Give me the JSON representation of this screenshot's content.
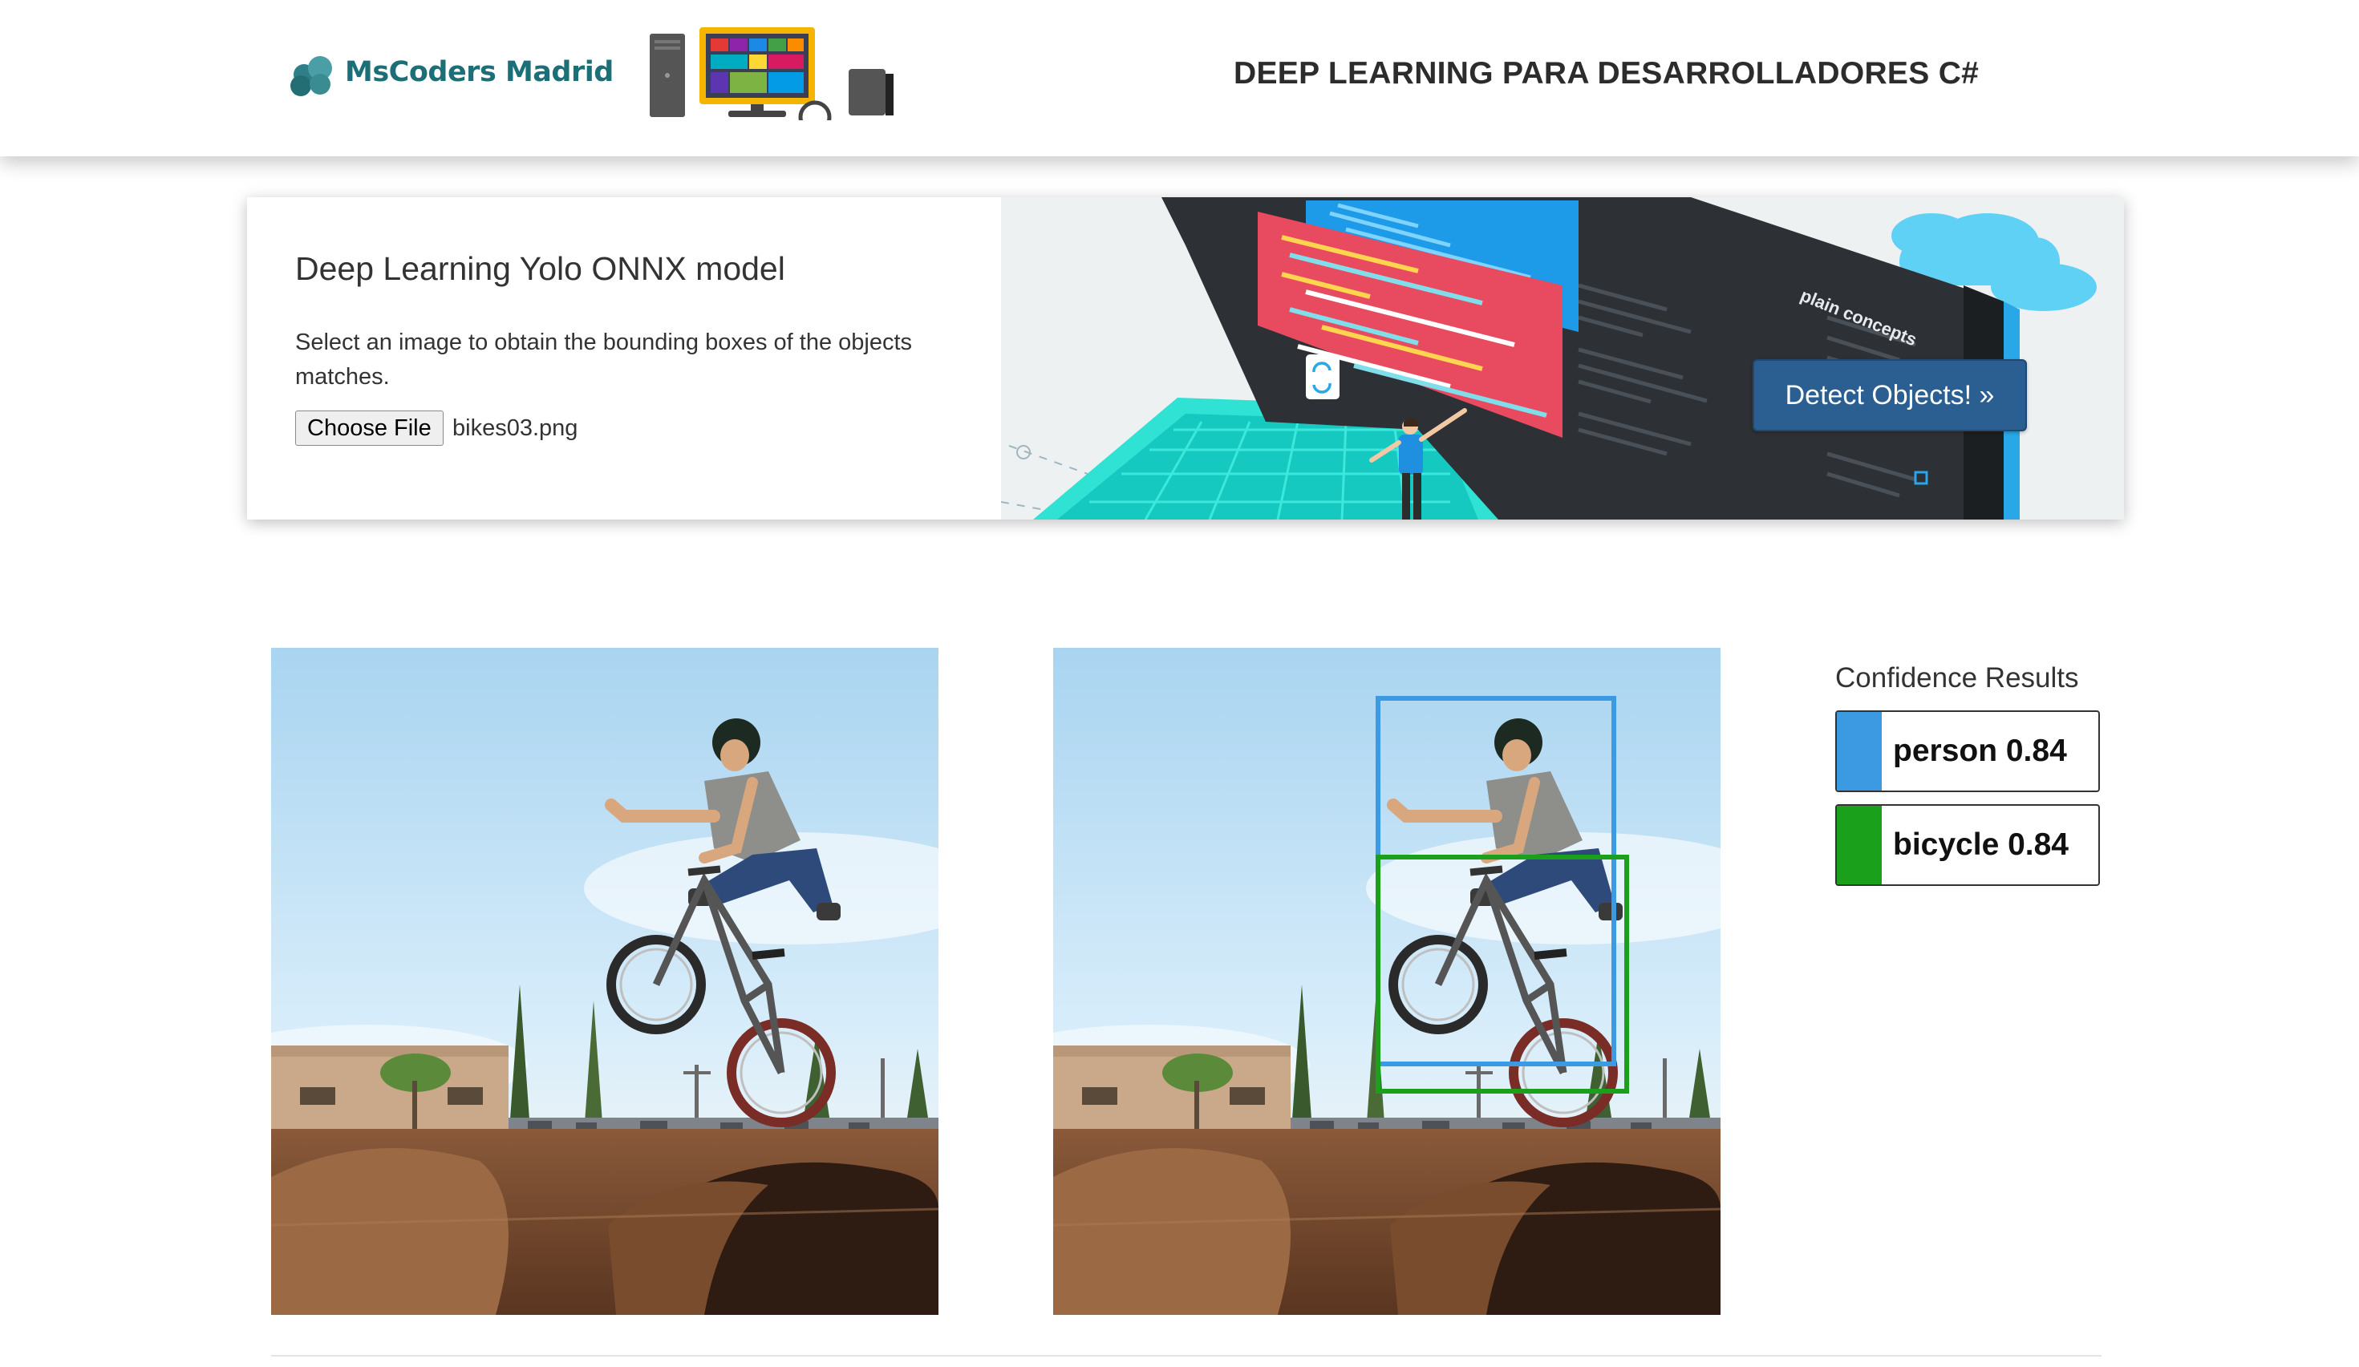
{
  "header": {
    "logo_text": "MsCoders Madrid",
    "title": "DEEP LEARNING PARA DESARROLLADORES C#"
  },
  "hero": {
    "heading": "Deep Learning Yolo ONNX model",
    "description": "Select an image to obtain the bounding boxes of the objects matches.",
    "file_button_label": "Choose File",
    "file_name": "bikes03.png",
    "detect_button_label": "Detect Objects! »",
    "art_logo_text": "plain concepts",
    "accent_color": "#2b5e91"
  },
  "results": {
    "title": "Confidence Results",
    "items": [
      {
        "label": "person 0.84",
        "color": "#3b9ae1"
      },
      {
        "label": "bicycle 0.84",
        "color": "#1aa01a"
      }
    ]
  },
  "icons": {
    "logo": "mscoders-logo-icon",
    "computer": "desktop-computer-icon",
    "refresh": "refresh-icon"
  }
}
